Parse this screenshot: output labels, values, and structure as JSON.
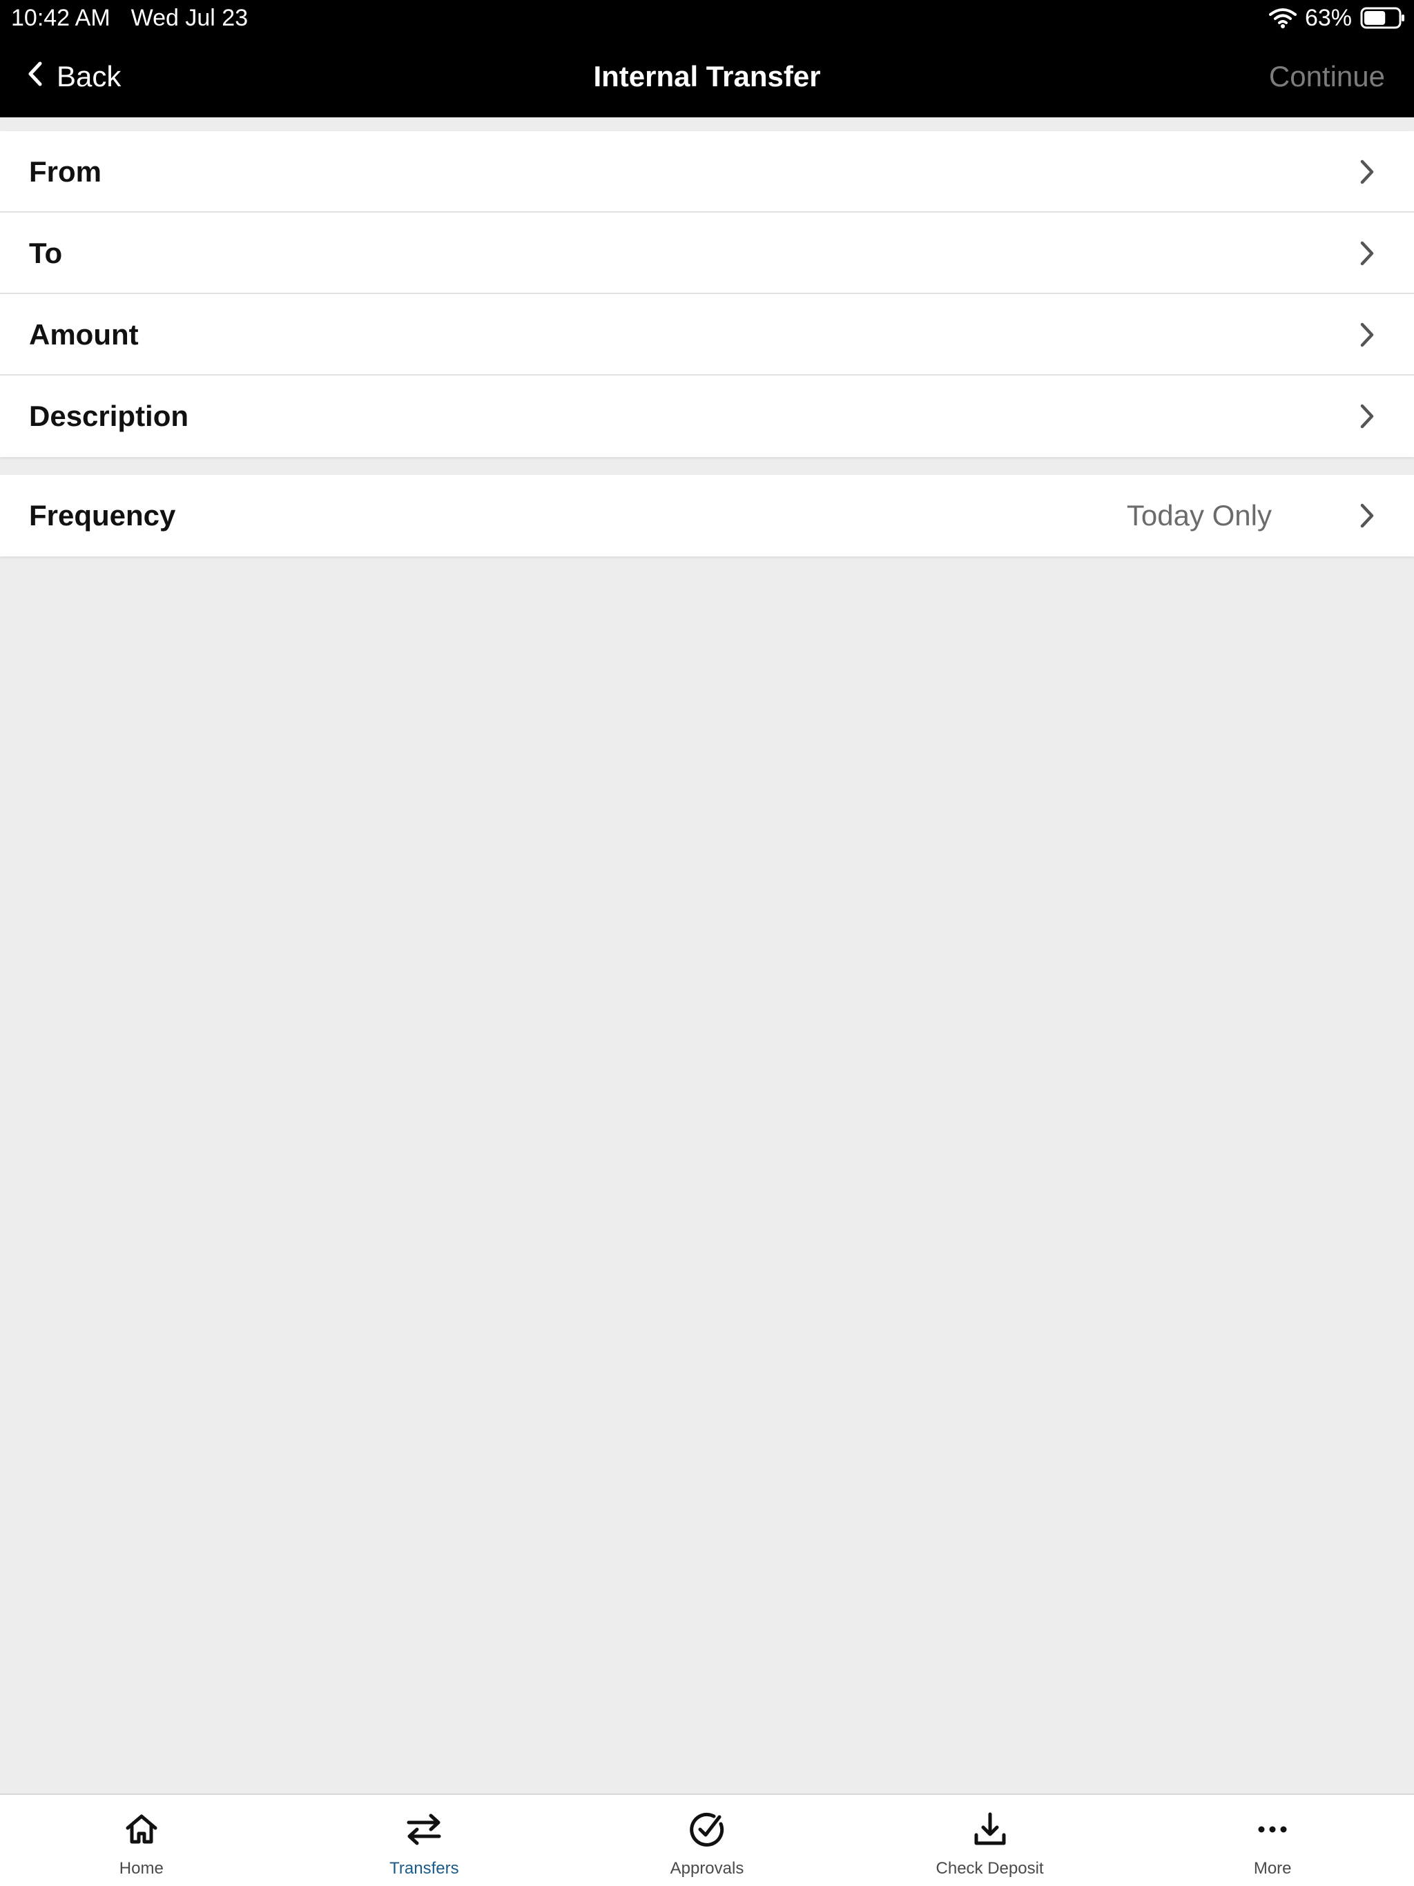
{
  "status_bar": {
    "time": "10:42 AM",
    "date": "Wed Jul 23",
    "battery_percent": "63%",
    "battery_level": 0.63
  },
  "nav": {
    "back_label": "Back",
    "title": "Internal Transfer",
    "continue_label": "Continue"
  },
  "form": {
    "rows": [
      {
        "label": "From"
      },
      {
        "label": "To"
      },
      {
        "label": "Amount"
      },
      {
        "label": "Description"
      }
    ],
    "frequency": {
      "label": "Frequency",
      "value": "Today Only"
    }
  },
  "tabbar": {
    "active": "transfers",
    "active_color": "#1a5a8a",
    "tabs": [
      {
        "label": "Home",
        "icon": "home-icon"
      },
      {
        "label": "Transfers",
        "icon": "transfer-arrows-icon"
      },
      {
        "label": "Approvals",
        "icon": "check-circle-icon"
      },
      {
        "label": "Check Deposit",
        "icon": "download-tray-icon"
      },
      {
        "label": "More",
        "icon": "more-dots-icon"
      }
    ]
  }
}
